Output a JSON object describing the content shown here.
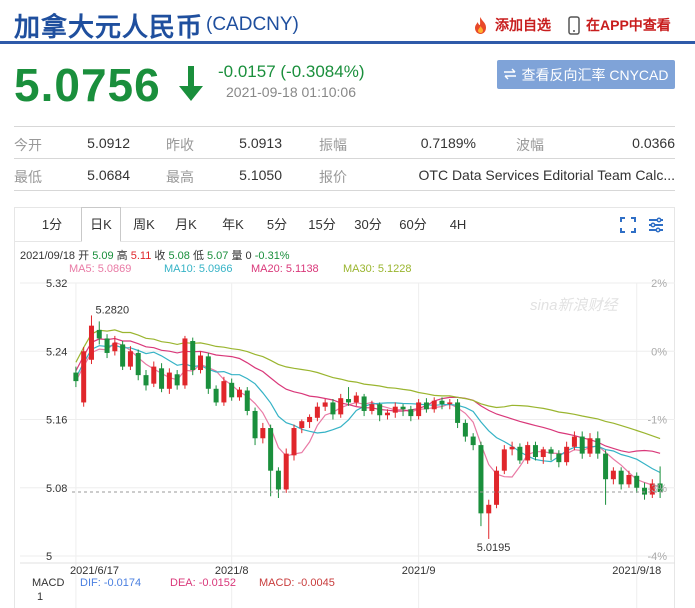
{
  "header": {
    "title": "加拿大元人民币",
    "code": "(CADCNY)",
    "add_watchlist": "添加自选",
    "view_in_app": "在APP中查看"
  },
  "quote": {
    "price": "5.0756",
    "change": "-0.0157 (-0.3084%)",
    "time": "2021-09-18 01:10:06",
    "reverse_button": "查看反向汇率 CNYCAD",
    "color_down": "#1a8f3c",
    "color_up": "#e0262b"
  },
  "stats": [
    [
      {
        "label": "今开",
        "value": "5.0912"
      },
      {
        "label": "昨收",
        "value": "5.0913"
      },
      {
        "label": "振幅",
        "value": "0.7189%"
      },
      {
        "label": "波幅",
        "value": "0.0366"
      }
    ],
    [
      {
        "label": "最低",
        "value": "5.0684"
      },
      {
        "label": "最高",
        "value": "5.1050"
      },
      {
        "label": "报价",
        "value": "OTC Data Services Editorial Team Calc..."
      }
    ]
  ],
  "periods": [
    "1分",
    "日K",
    "周K",
    "月K",
    "年K",
    "5分",
    "15分",
    "30分",
    "60分",
    "4H"
  ],
  "active_period": "日K",
  "info": {
    "date": "2021/09/18",
    "open_label": "开",
    "open": "5.09",
    "high_label": "高",
    "high": "5.11",
    "close_label": "收",
    "close": "5.08",
    "low_label": "低",
    "low": "5.07",
    "vol_label": "量",
    "vol": "0",
    "pct": "-0.31%"
  },
  "ma_legend": [
    {
      "text": "MA5: 5.0869",
      "color": "#e97aa5"
    },
    {
      "text": "MA10: 5.0966",
      "color": "#36b3c6"
    },
    {
      "text": "MA20: 5.1138",
      "color": "#d9387a"
    },
    {
      "text": "MA30: 5.1228",
      "color": "#9ab52f"
    }
  ],
  "macd_legend": [
    {
      "text": "MACD",
      "color": "#333333"
    },
    {
      "text": "DIF: -0.0174",
      "color": "#4a7fe0"
    },
    {
      "text": "DEA: -0.0152",
      "color": "#d9387a"
    },
    {
      "text": "MACD: -0.0045",
      "color": "#c83c3c"
    }
  ],
  "macd_axis_label": "1",
  "watermark": "sina新浪财经",
  "chart_data": {
    "type": "candlestick",
    "y_ticks": [
      "5.32",
      "5.24",
      "5.16",
      "5.08",
      "5"
    ],
    "y_ticks_right": [
      "2%",
      "0%",
      "-1%",
      "-3%",
      "-4%"
    ],
    "x_ticks": [
      "2021/6/17",
      "2021/8",
      "2021/9",
      "2021/9/18"
    ],
    "max_label": "5.2820",
    "min_label": "5.0195",
    "ylim": [
      5.0,
      5.32
    ],
    "candles": [
      [
        5.215,
        5.205,
        5.222,
        5.198
      ],
      [
        5.18,
        5.24,
        5.245,
        5.175
      ],
      [
        5.23,
        5.27,
        5.282,
        5.225
      ],
      [
        5.265,
        5.255,
        5.275,
        5.248
      ],
      [
        5.255,
        5.238,
        5.26,
        5.232
      ],
      [
        5.24,
        5.25,
        5.258,
        5.235
      ],
      [
        5.248,
        5.222,
        5.252,
        5.218
      ],
      [
        5.222,
        5.24,
        5.246,
        5.218
      ],
      [
        5.238,
        5.212,
        5.242,
        5.206
      ],
      [
        5.212,
        5.2,
        5.218,
        5.194
      ],
      [
        5.202,
        5.222,
        5.228,
        5.198
      ],
      [
        5.22,
        5.196,
        5.226,
        5.192
      ],
      [
        5.196,
        5.215,
        5.22,
        5.19
      ],
      [
        5.213,
        5.2,
        5.218,
        5.195
      ],
      [
        5.2,
        5.255,
        5.258,
        5.196
      ],
      [
        5.252,
        5.218,
        5.256,
        5.212
      ],
      [
        5.218,
        5.235,
        5.24,
        5.214
      ],
      [
        5.234,
        5.196,
        5.238,
        5.19
      ],
      [
        5.196,
        5.18,
        5.2,
        5.176
      ],
      [
        5.18,
        5.205,
        5.21,
        5.176
      ],
      [
        5.203,
        5.186,
        5.208,
        5.182
      ],
      [
        5.186,
        5.195,
        5.198,
        5.182
      ],
      [
        5.194,
        5.17,
        5.198,
        5.165
      ],
      [
        5.17,
        5.138,
        5.174,
        5.13
      ],
      [
        5.138,
        5.15,
        5.156,
        5.132
      ],
      [
        5.15,
        5.1,
        5.154,
        5.07
      ],
      [
        5.1,
        5.078,
        5.104,
        5.068
      ],
      [
        5.078,
        5.12,
        5.126,
        5.074
      ],
      [
        5.118,
        5.15,
        5.154,
        5.112
      ],
      [
        5.15,
        5.158,
        5.16,
        5.144
      ],
      [
        5.157,
        5.163,
        5.166,
        5.15
      ],
      [
        5.162,
        5.175,
        5.18,
        5.158
      ],
      [
        5.175,
        5.18,
        5.184,
        5.17
      ],
      [
        5.18,
        5.166,
        5.184,
        5.16
      ],
      [
        5.166,
        5.185,
        5.19,
        5.162
      ],
      [
        5.184,
        5.18,
        5.198,
        5.176
      ],
      [
        5.18,
        5.188,
        5.192,
        5.176
      ],
      [
        5.187,
        5.17,
        5.19,
        5.164
      ],
      [
        5.17,
        5.178,
        5.182,
        5.166
      ],
      [
        5.178,
        5.165,
        5.18,
        5.158
      ],
      [
        5.165,
        5.168,
        5.172,
        5.16
      ],
      [
        5.168,
        5.175,
        5.18,
        5.162
      ],
      [
        5.175,
        5.172,
        5.178,
        5.164
      ],
      [
        5.172,
        5.164,
        5.176,
        5.158
      ],
      [
        5.164,
        5.18,
        5.184,
        5.16
      ],
      [
        5.18,
        5.172,
        5.185,
        5.168
      ],
      [
        5.172,
        5.182,
        5.186,
        5.168
      ],
      [
        5.182,
        5.178,
        5.186,
        5.172
      ],
      [
        5.178,
        5.18,
        5.184,
        5.172
      ],
      [
        5.18,
        5.156,
        5.184,
        5.15
      ],
      [
        5.156,
        5.14,
        5.16,
        5.134
      ],
      [
        5.14,
        5.13,
        5.144,
        5.124
      ],
      [
        5.13,
        5.05,
        5.134,
        5.035
      ],
      [
        5.05,
        5.06,
        5.066,
        5.02
      ],
      [
        5.06,
        5.1,
        5.105,
        5.056
      ],
      [
        5.1,
        5.125,
        5.13,
        5.096
      ],
      [
        5.125,
        5.128,
        5.134,
        5.118
      ],
      [
        5.128,
        5.112,
        5.132,
        5.108
      ],
      [
        5.112,
        5.13,
        5.134,
        5.108
      ],
      [
        5.13,
        5.116,
        5.134,
        5.112
      ],
      [
        5.116,
        5.125,
        5.128,
        5.108
      ],
      [
        5.125,
        5.12,
        5.128,
        5.112
      ],
      [
        5.12,
        5.11,
        5.124,
        5.104
      ],
      [
        5.11,
        5.128,
        5.134,
        5.106
      ],
      [
        5.128,
        5.14,
        5.146,
        5.124
      ],
      [
        5.14,
        5.12,
        5.146,
        5.114
      ],
      [
        5.12,
        5.138,
        5.144,
        5.116
      ],
      [
        5.138,
        5.12,
        5.146,
        5.114
      ],
      [
        5.12,
        5.09,
        5.124,
        5.06
      ],
      [
        5.09,
        5.1,
        5.104,
        5.084
      ],
      [
        5.1,
        5.084,
        5.104,
        5.078
      ],
      [
        5.084,
        5.095,
        5.1,
        5.08
      ],
      [
        5.094,
        5.08,
        5.098,
        5.074
      ],
      [
        5.08,
        5.072,
        5.086,
        5.066
      ],
      [
        5.072,
        5.085,
        5.09,
        5.068
      ],
      [
        5.085,
        5.075,
        5.105,
        5.068
      ]
    ]
  }
}
